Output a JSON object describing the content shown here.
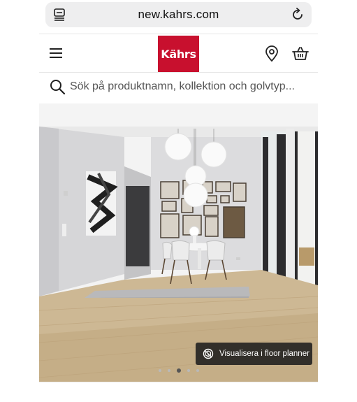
{
  "browser": {
    "url": "new.kahrs.com",
    "tabs_icon": "tabs-icon",
    "reload_icon": "reload-icon"
  },
  "header": {
    "menu_icon": "hamburger-menu-icon",
    "logo_text": "Kährs",
    "logo_color": "#c8102e",
    "location_icon": "map-pin-icon",
    "cart_icon": "shopping-basket-icon"
  },
  "search": {
    "placeholder": "Sök på produktnamn, kollektion och golvtyp...",
    "value": "",
    "icon": "search-icon"
  },
  "hero": {
    "planner_label": "Visualisera i floor planner",
    "planner_icon": "floor-planner-icon",
    "slide_count": 5,
    "active_slide": 3
  }
}
